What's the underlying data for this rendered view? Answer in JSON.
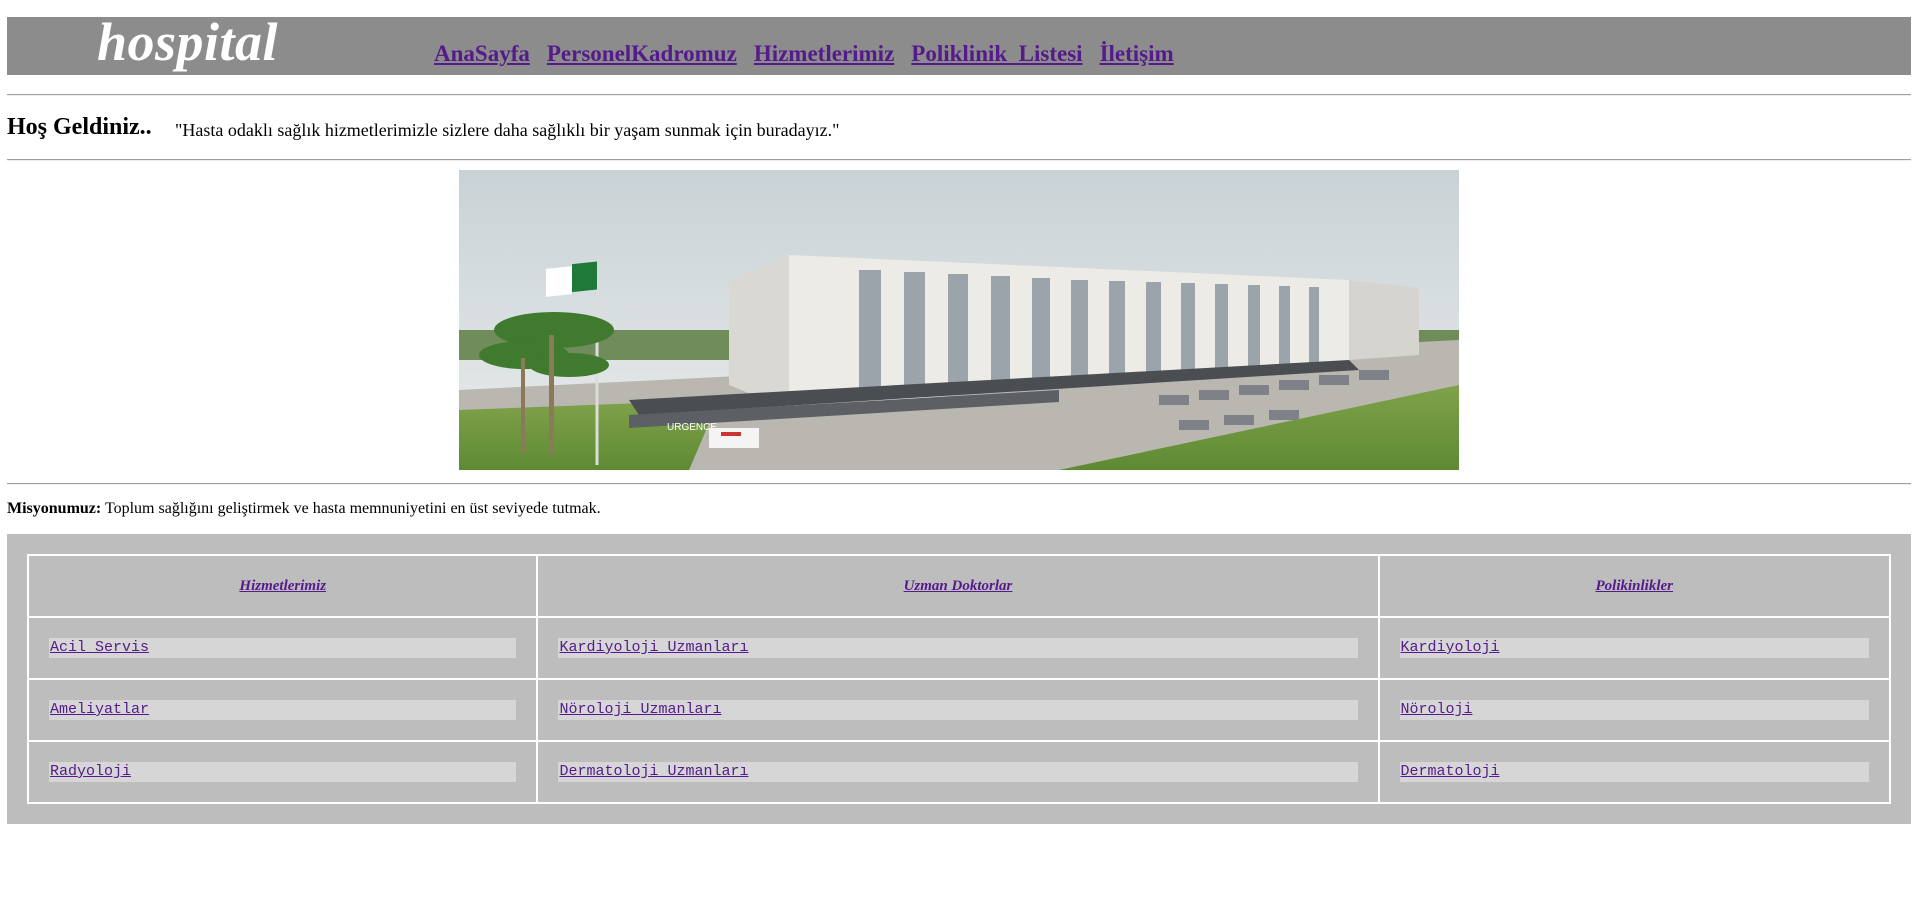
{
  "header": {
    "brand": "hospital",
    "nav": [
      "AnaSayfa",
      "PersonelKadromuz",
      "Hizmetlerimiz",
      "Poliklinik  Listesi",
      "İletişim"
    ]
  },
  "welcome": {
    "title": "Hoş Geldiniz..",
    "tagline": "\"Hasta odaklı sağlık hizmetlerimizle sizlere daha sağlıklı bir yaşam sunmak için buradayız.\""
  },
  "hero": {
    "sign_text": "URGENCE"
  },
  "mission": {
    "label": "Misyonumuz:",
    "text": " Toplum sağlığını geliştirmek ve hasta memnuniyetini en üst seviyede tutmak."
  },
  "table": {
    "headers": [
      "Hizmetlerimiz",
      "Uzman Doktorlar",
      "Polikinlikler"
    ],
    "rows": [
      [
        "Acil Servis",
        "Kardiyoloji Uzmanları",
        "Kardiyoloji"
      ],
      [
        "Ameliyatlar",
        "Nöroloji Uzmanları",
        "Nöroloji"
      ],
      [
        "Radyoloji",
        "Dermatoloji Uzmanları",
        "Dermatoloji"
      ]
    ]
  },
  "colors": {
    "banner": "#8c8c8c",
    "panel": "#bdbdbd",
    "link": "#551a8b",
    "cell": "#d6d6d6"
  }
}
